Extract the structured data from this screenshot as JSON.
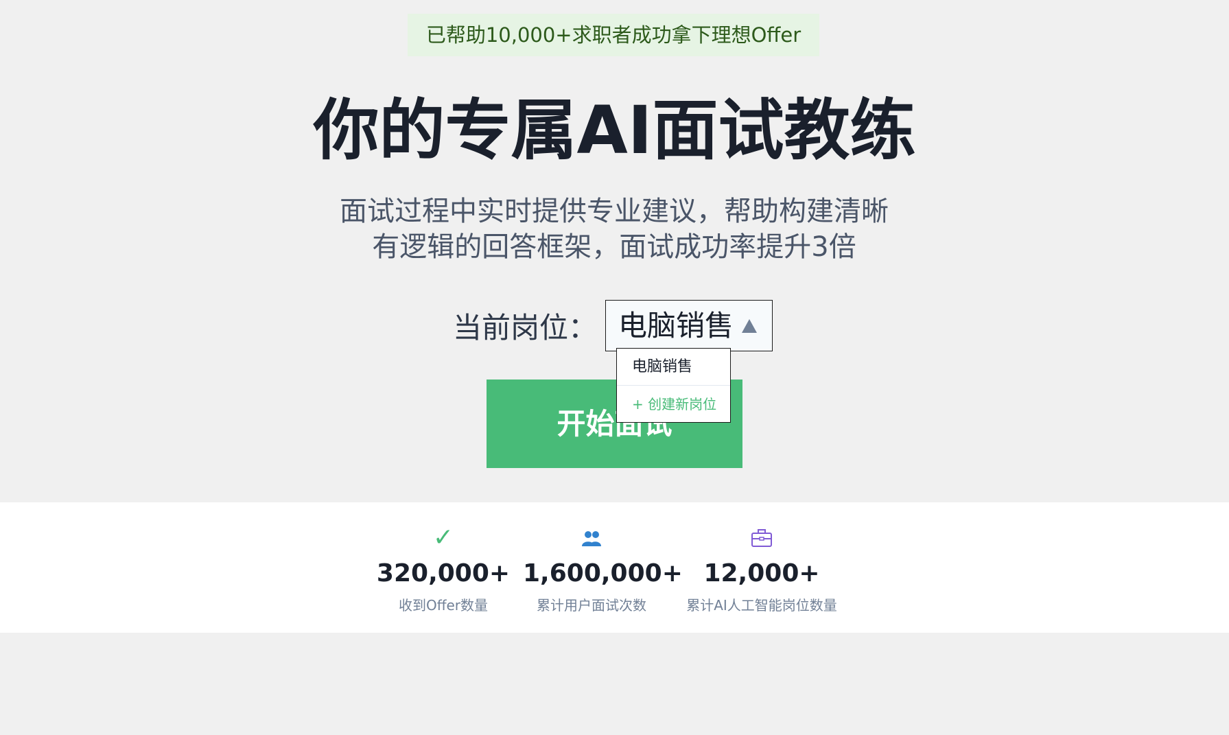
{
  "badge": "已帮助10,000+求职者成功拿下理想Offer",
  "title": "你的专属AI面试教练",
  "subtitle": {
    "line1": "面试过程中实时提供专业建议，帮助构建清晰",
    "line2": "有逻辑的回答框架，面试成功率提升3倍"
  },
  "position": {
    "label": "当前岗位：",
    "selected": "电脑销售",
    "options": [
      "电脑销售"
    ],
    "create_label": "+ 创建新岗位"
  },
  "start_button": "开始面试",
  "stats": [
    {
      "icon": "check-icon",
      "value": "320,000+",
      "label": "收到Offer数量"
    },
    {
      "icon": "users-icon",
      "value": "1,600,000+",
      "label": "累计用户面试次数"
    },
    {
      "icon": "briefcase-icon",
      "value": "12,000+",
      "label": "累计AI人工智能岗位数量"
    }
  ],
  "colors": {
    "accent": "#48bb78",
    "badge_bg": "#e6f4e4",
    "badge_text": "#2d5a1b",
    "users_icon": "#3182ce",
    "briefcase_icon": "#805ad5"
  }
}
